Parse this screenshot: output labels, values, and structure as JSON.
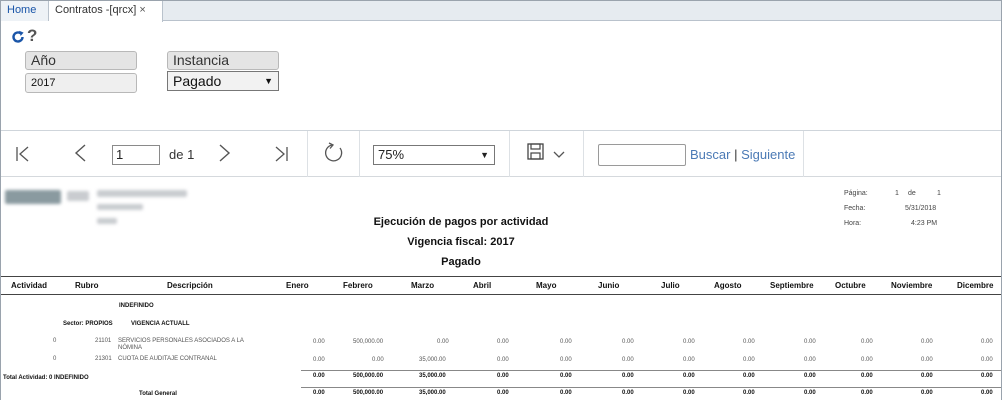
{
  "tabs": [
    {
      "label": "Home"
    },
    {
      "label": "Contratos -[qrcx]",
      "close": "×"
    }
  ],
  "params": {
    "help_glyph": "?",
    "anio_label": "Año",
    "anio_value": "2017",
    "instancia_label": "Instancia",
    "instancia_value": "Pagado"
  },
  "toolbar": {
    "page_value": "1",
    "page_of": "de 1",
    "zoom_value": "75%",
    "search_placeholder": "",
    "buscar": "Buscar",
    "separator": "|",
    "siguiente": "Siguiente"
  },
  "report": {
    "meta_labels": {
      "pagina": "Página:",
      "fecha": "Fecha:",
      "hora": "Hora:"
    },
    "meta_values": {
      "pagina_num": "1",
      "pagina_de": "de",
      "pagina_total": "1",
      "fecha": "5/31/2018",
      "hora": "4:23 PM"
    },
    "title1": "Ejecución de pagos por actividad",
    "title2": "Vigencia fiscal: 2017",
    "title3": "Pagado",
    "headers": [
      "Actividad",
      "Rubro",
      "Descripción",
      "Enero",
      "Febrero",
      "Marzo",
      "Abril",
      "Mayo",
      "Junio",
      "Julio",
      "Agosto",
      "Septiembre",
      "Octubre",
      "Noviembre",
      "Dicembre"
    ],
    "group_label": "INDEFINIDO",
    "sector_label": "Sector: PROPIOS",
    "sector_name": "VIGENCIA ACTUALL",
    "rows": [
      {
        "actividad": "0",
        "rubro": "21101",
        "descripcion": "SERVICIOS PERSONALES ASOCIADOS A LA NÓMINA",
        "values": [
          "0.00",
          "500,000.00",
          "0.00",
          "0.00",
          "0.00",
          "0.00",
          "0.00",
          "0.00",
          "0.00",
          "0.00",
          "0.00",
          "0.00"
        ]
      },
      {
        "actividad": "0",
        "rubro": "21301",
        "descripcion": "CUOTA DE AUDITAJE CONTRANAL",
        "values": [
          "0.00",
          "0.00",
          "35,000.00",
          "0.00",
          "0.00",
          "0.00",
          "0.00",
          "0.00",
          "0.00",
          "0.00",
          "0.00",
          "0.00"
        ]
      }
    ],
    "total_actividad": {
      "label": "Total Actividad: 0  INDEFINIDO",
      "values": [
        "0.00",
        "500,000.00",
        "35,000.00",
        "0.00",
        "0.00",
        "0.00",
        "0.00",
        "0.00",
        "0.00",
        "0.00",
        "0.00",
        "0.00"
      ]
    },
    "total_general": {
      "label": "Total General",
      "values": [
        "0.00",
        "500,000.00",
        "35,000.00",
        "0.00",
        "0.00",
        "0.00",
        "0.00",
        "0.00",
        "0.00",
        "0.00",
        "0.00",
        "0.00"
      ]
    }
  },
  "colors": {
    "accent": "#1a55a8",
    "link": "#4b7ab5"
  }
}
